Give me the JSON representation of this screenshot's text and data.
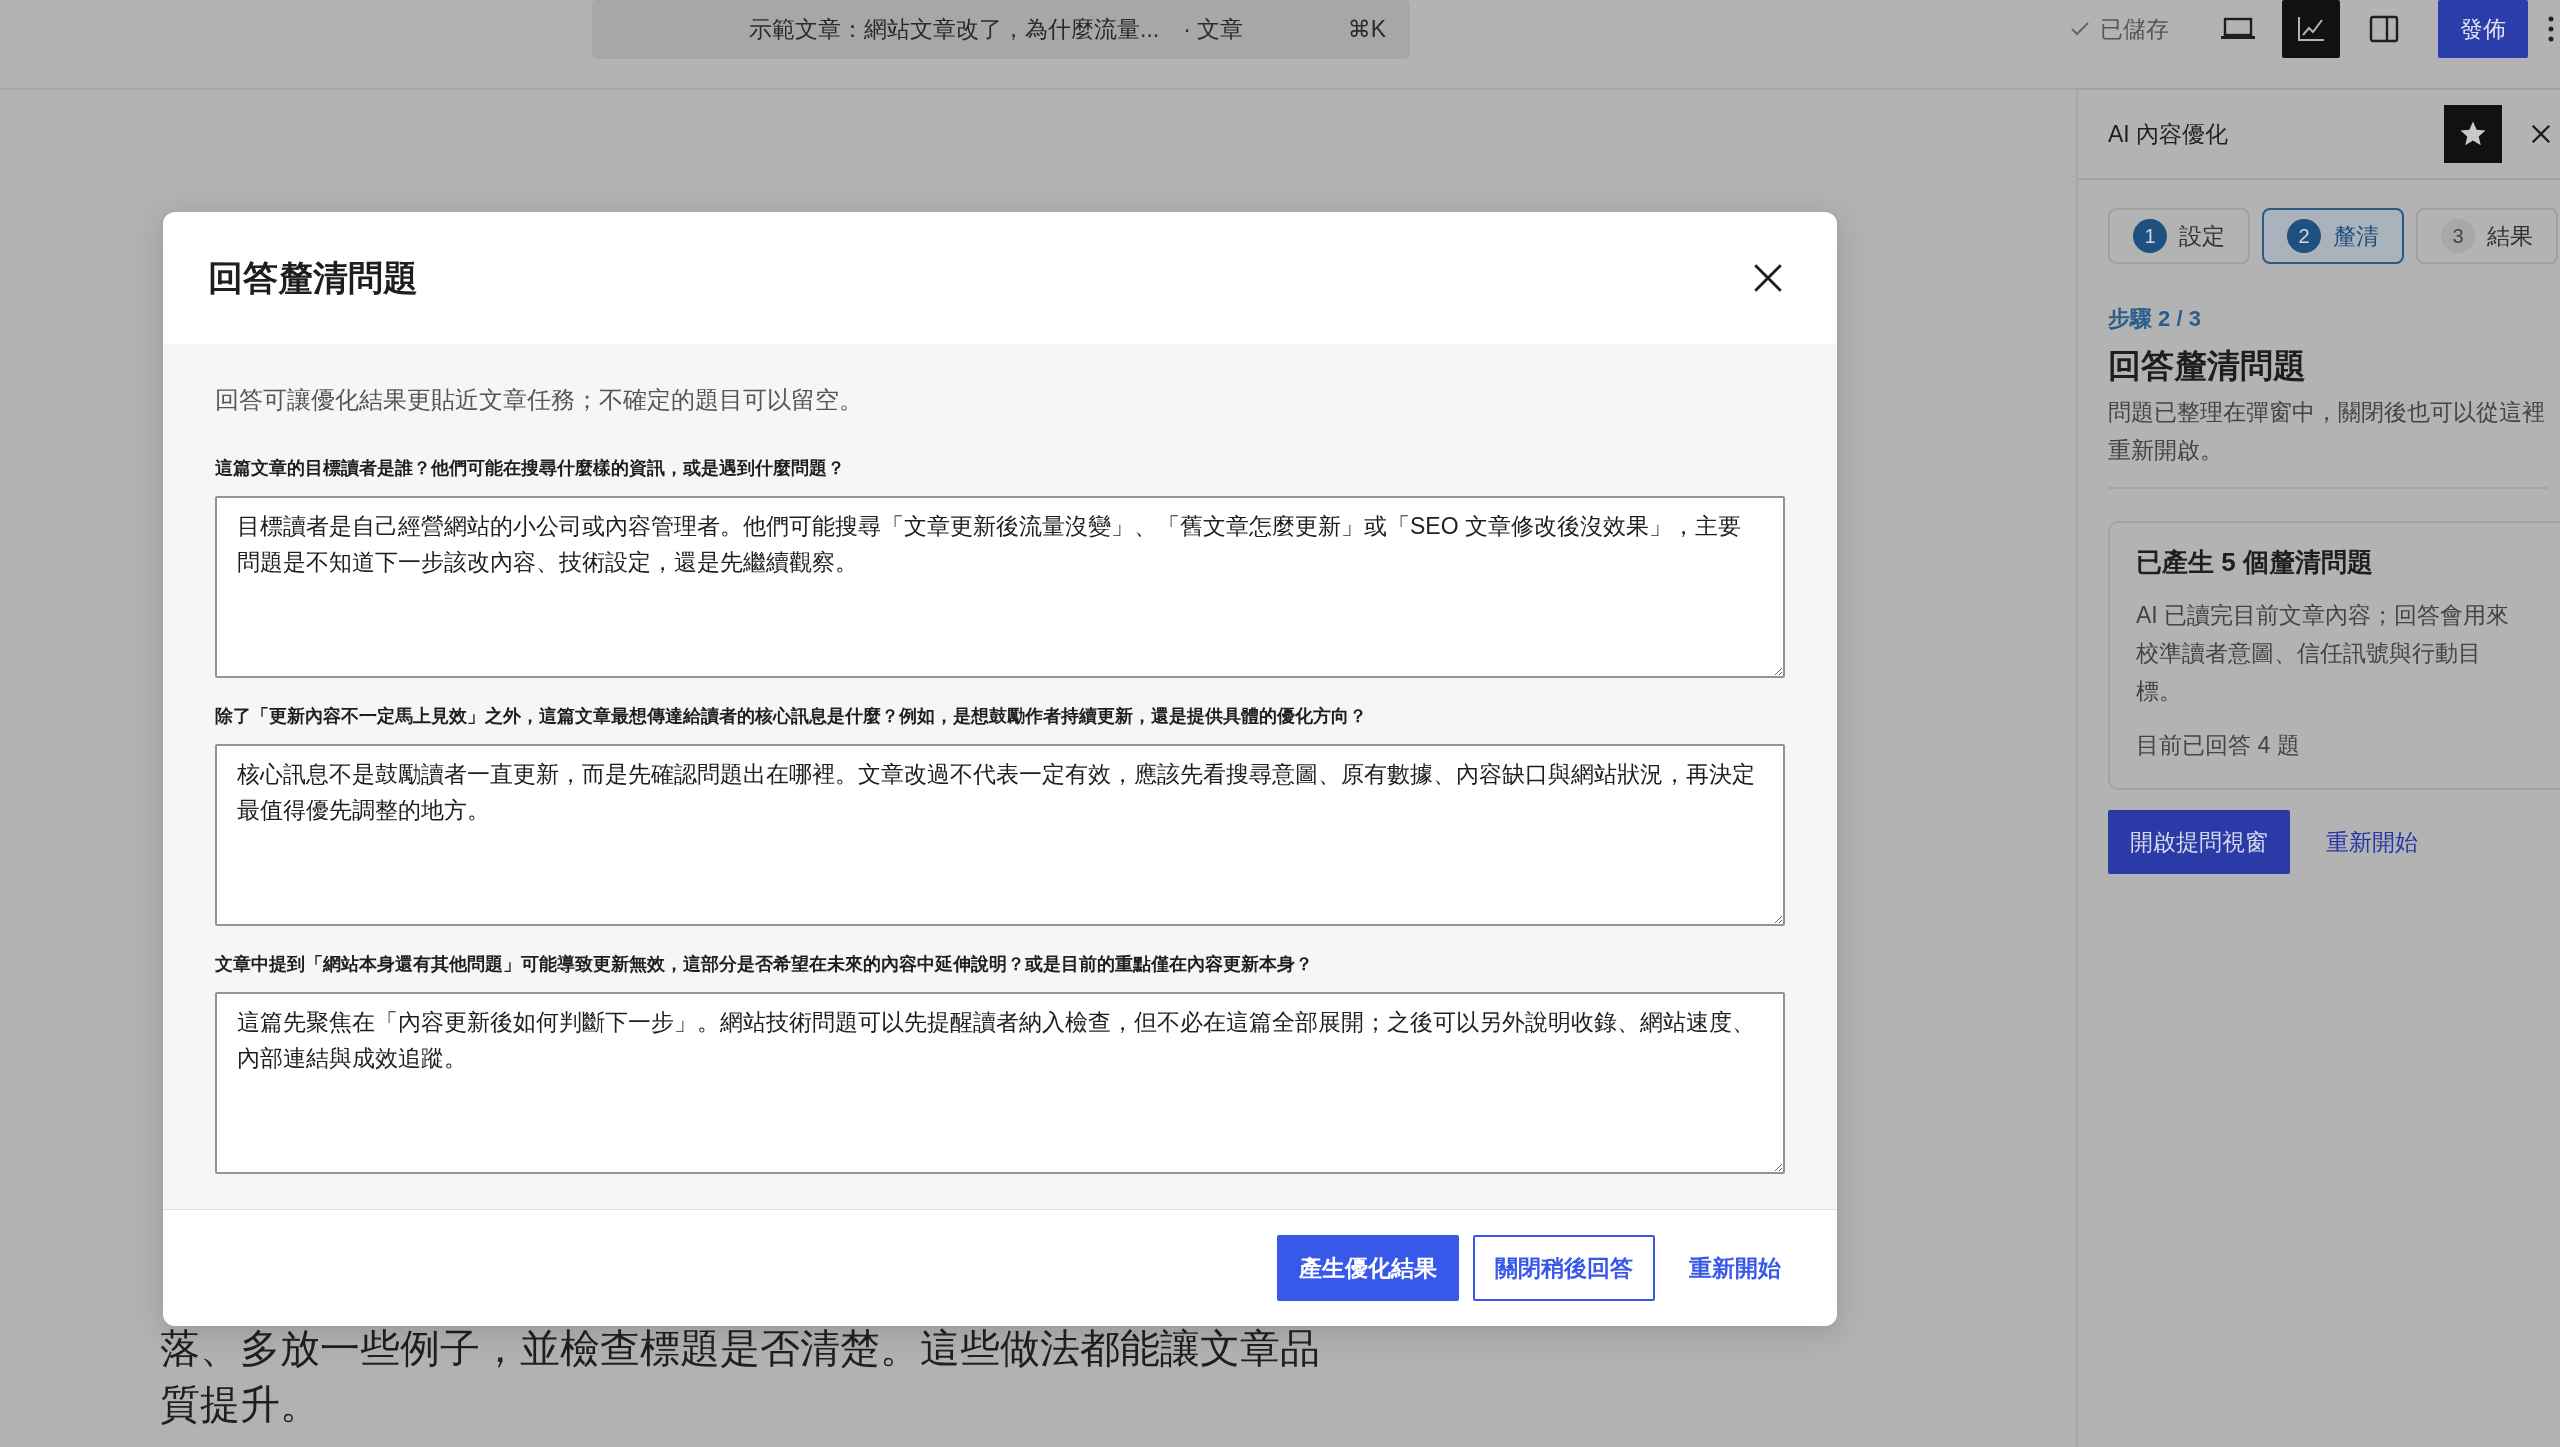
{
  "top_bar": {
    "document_title": "示範文章：網站文章改了，為什麼流量...",
    "post_type": "· 文章",
    "shortcut": "⌘K",
    "save_status": "已儲存",
    "tools": [
      {
        "kind": "desktop",
        "selected": false
      },
      {
        "kind": "chart",
        "selected": true
      },
      {
        "kind": "sidebar",
        "selected": false
      }
    ],
    "publish_button": "發佈"
  },
  "editor": {
    "paragraph_lines": [
      "落、多放一些例子，並檢查標題是否清楚。這些做法都能讓文章品",
      "質提升。"
    ]
  },
  "sidebar": {
    "title": "AI 內容優化",
    "steps": [
      {
        "number": "1",
        "label": "設定",
        "selected": false,
        "reached": true
      },
      {
        "number": "2",
        "label": "釐清",
        "selected": true,
        "reached": true
      },
      {
        "number": "3",
        "label": "結果",
        "selected": false,
        "reached": false
      }
    ],
    "step_label": "步驟 2 / 3",
    "heading": "回答釐清問題",
    "description": "問題已整理在彈窗中，關閉後也可以從這裡重新開啟。",
    "card": {
      "title": "已產生 5 個釐清問題",
      "body": "AI 已讀完目前文章內容；回答會用來校準讀者意圖、信任訊號與行動目標。",
      "answered": "目前已回答 4 題"
    },
    "buttons": [
      {
        "kind": "primary",
        "label": "開啟提問視窗"
      },
      {
        "kind": "link",
        "label": "重新開始"
      }
    ]
  },
  "dialog": {
    "title": "回答釐清問題",
    "intro": "回答可讓優化結果更貼近文章任務；不確定的題目可以留空。",
    "questions": [
      {
        "label": "這篇文章的目標讀者是誰？他們可能在搜尋什麼樣的資訊，或是遇到什麼問題？",
        "answer": "目標讀者是自己經營網站的小公司或內容管理者。他們可能搜尋「文章更新後流量沒變」、「舊文章怎麼更新」或「SEO 文章修改後沒效果」，主要問題是不知道下一步該改內容、技術設定，還是先繼續觀察。"
      },
      {
        "label": "除了「更新內容不一定馬上見效」之外，這篇文章最想傳達給讀者的核心訊息是什麼？例如，是想鼓勵作者持續更新，還是提供具體的優化方向？",
        "answer": "核心訊息不是鼓勵讀者一直更新，而是先確認問題出在哪裡。文章改過不代表一定有效，應該先看搜尋意圖、原有數據、內容缺口與網站狀況，再決定最值得優先調整的地方。"
      },
      {
        "label": "文章中提到「網站本身還有其他問題」可能導致更新無效，這部分是否希望在未來的內容中延伸說明？或是目前的重點僅在內容更新本身？",
        "answer": "這篇先聚焦在「內容更新後如何判斷下一步」。網站技術問題可以先提醒讀者納入檢查，但不必在這篇全部展開；之後可以另外說明收錄、網站速度、內部連結與成效追蹤。"
      }
    ],
    "buttons": [
      {
        "kind": "primary",
        "label": "產生優化結果"
      },
      {
        "kind": "outline",
        "label": "關閉稍後回答"
      },
      {
        "kind": "link",
        "label": "重新開始"
      }
    ]
  }
}
